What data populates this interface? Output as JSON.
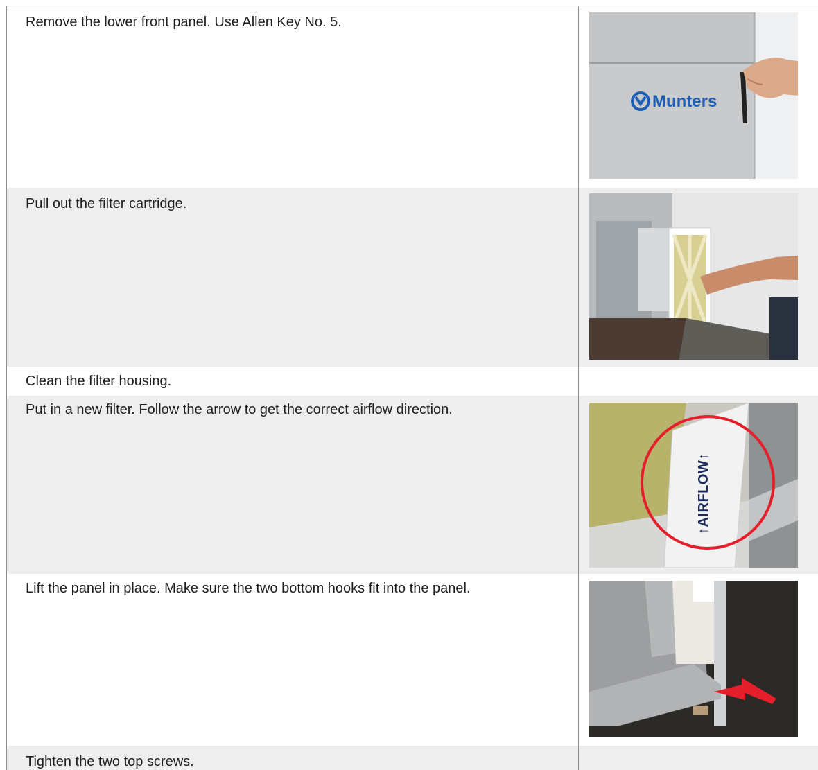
{
  "steps": [
    {
      "text": "Remove the lower front panel. Use Allen Key No. 5.",
      "image": "munters-panel-allen-key-photo",
      "logo_text": "Munters",
      "shaded": false
    },
    {
      "text": "Pull out the filter cartridge.",
      "image": "filter-cartridge-removal-photo",
      "shaded": true
    },
    {
      "text": "Clean the filter housing.",
      "image": "",
      "shaded": false
    },
    {
      "text": "Put in a new filter. Follow the arrow to get the correct airflow direction.",
      "image": "airflow-arrow-filter-photo",
      "airflow_label": "↑AIRFLOW↑",
      "shaded": true
    },
    {
      "text": "Lift the panel in place. Make sure the two bottom hooks fit into the panel.",
      "image": "panel-bottom-hooks-photo",
      "shaded": false
    },
    {
      "text": "Tighten the two top screws.",
      "image": "",
      "shaded": true
    }
  ],
  "colors": {
    "accent_red": "#e41f2b",
    "munters_blue": "#1d5fb5",
    "border": "#8c8c8c",
    "shade": "#eeeeee"
  }
}
